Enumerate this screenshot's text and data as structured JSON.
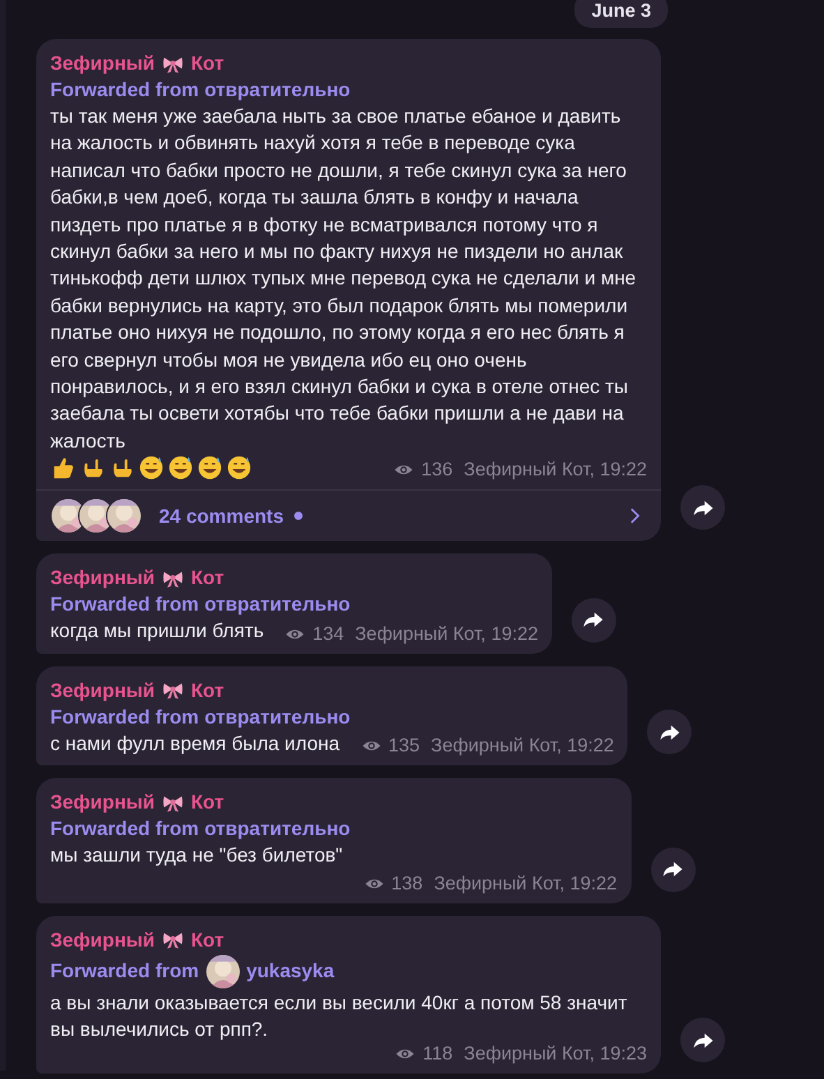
{
  "date_badge": "June 3",
  "messages": [
    {
      "author": {
        "first": "Зефирный",
        "last": "Кот"
      },
      "forward": {
        "label": "Forwarded from",
        "source": "отвратительно"
      },
      "text": "ты так меня уже заебала ныть за свое платье ебаное и давить на жалость и обвинять нахуй хотя я тебе в переводе сука написал что бабки просто не дошли, я тебе скинул сука за него бабки,в чем доеб, когда ты зашла блять в конфу и начала пиздеть про платье я в фотку не всматривался потому что я скинул бабки за него и мы по факту нихуя не пиздели но анлак тинькофф дети шлюх тупых мне перевод сука не сделали и мне бабки вернулись на карту, это был подарок блять мы померили платье оно нихуя не подошло, по этому когда я его нес блять я его свернул чтобы моя не увидела ибо ец оно очень понравилось, и я его взял скинул бабки и сука в отеле отнес ты заебала ты освети хотябы что тебе бабки пришли а не дави на жалость",
      "emoji": [
        {
          "kind": "thumb"
        },
        {
          "kind": "hand"
        },
        {
          "kind": "hand"
        },
        {
          "kind": "sweat"
        },
        {
          "kind": "sweat"
        },
        {
          "kind": "sweat"
        },
        {
          "kind": "sweat"
        }
      ],
      "views": "136",
      "signature": "Зефирный Кот, 19:22",
      "comments": {
        "label": "24 comments",
        "unread": true
      }
    },
    {
      "author": {
        "first": "Зефирный",
        "last": "Кот"
      },
      "forward": {
        "label": "Forwarded from",
        "source": "отвратительно"
      },
      "text": "когда мы пришли блять",
      "views": "134",
      "signature": "Зефирный Кот, 19:22"
    },
    {
      "author": {
        "first": "Зефирный",
        "last": "Кот"
      },
      "forward": {
        "label": "Forwarded from",
        "source": "отвратительно"
      },
      "text": "с нами фулл время была илона",
      "views": "135",
      "signature": "Зефирный Кот, 19:22"
    },
    {
      "author": {
        "first": "Зефирный",
        "last": "Кот"
      },
      "forward": {
        "label": "Forwarded from",
        "source": "отвратительно"
      },
      "text": "мы зашли туда не \"без билетов\"",
      "views": "138",
      "signature": "Зефирный Кот, 19:22",
      "meta_below": true
    },
    {
      "author": {
        "first": "Зефирный",
        "last": "Кот"
      },
      "forward": {
        "label": "Forwarded from",
        "source": "yukasyka"
      },
      "text": "а вы знали оказывается если вы весили 40кг а потом 58 значит вы вылечились от рпп?.",
      "views": "118",
      "signature": "Зефирный Кот, 19:23"
    }
  ]
}
